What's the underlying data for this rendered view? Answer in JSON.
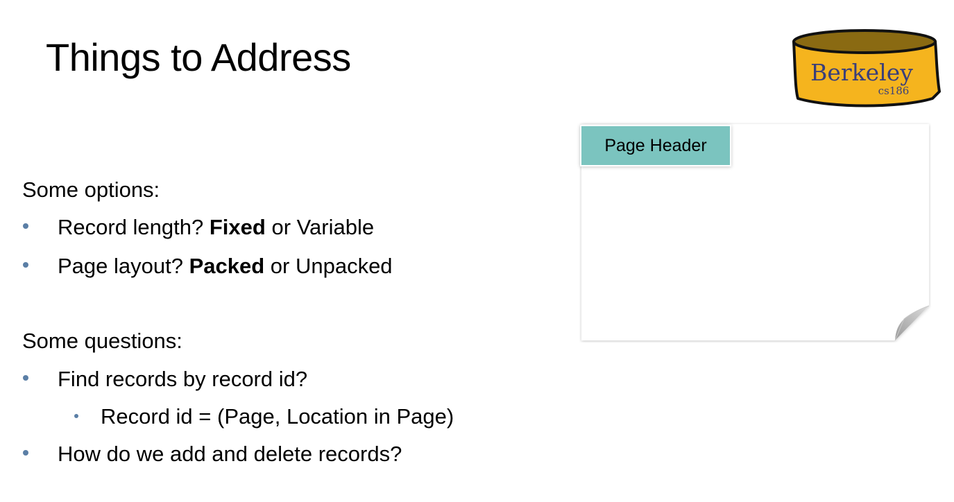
{
  "title": "Things to Address",
  "logo": {
    "main_text": "Berkeley",
    "sub_text": "cs186",
    "colors": {
      "fill": "#f5b41e",
      "rim": "#8a6a12",
      "outline": "#111111"
    }
  },
  "options": {
    "heading": "Some options:",
    "items": [
      {
        "prefix": "Record length? ",
        "bold": "Fixed",
        "suffix": " or Variable"
      },
      {
        "prefix": "Page layout? ",
        "bold": "Packed",
        "suffix": " or Unpacked"
      }
    ]
  },
  "questions": {
    "heading": "Some questions:",
    "item1": "Find records by record id?",
    "subitem": "Record id = (Page, Location in Page)",
    "item2": "How do we add and delete records?"
  },
  "diagram": {
    "header_label": "Page Header",
    "header_color": "#7bc4bf"
  },
  "colors": {
    "bullet": "#5b7fa6"
  }
}
